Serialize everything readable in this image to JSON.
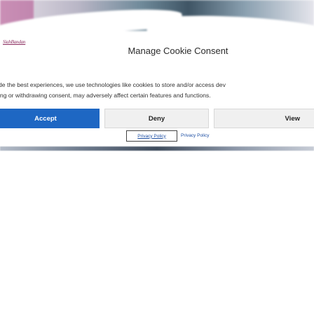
{
  "background": {
    "logo_text": "SiahBandan"
  },
  "banner": {
    "title": "Manage Cookie Consent",
    "body_lines": [
      "de the best experiences, we use technologies like cookies to store and/or access dev",
      "ing or withdrawing consent, may adversely affect certain features and functions."
    ],
    "buttons": {
      "accept": "Accept",
      "deny": "Deny",
      "view": "View"
    },
    "links": {
      "privacy_policy_1": "Privacy Policy",
      "privacy_policy_2": "Privacy Policy"
    },
    "colors": {
      "accept_bg": "#1e67c3",
      "secondary_bg": "#f0f0f0",
      "link": "#1e4fa3"
    }
  }
}
